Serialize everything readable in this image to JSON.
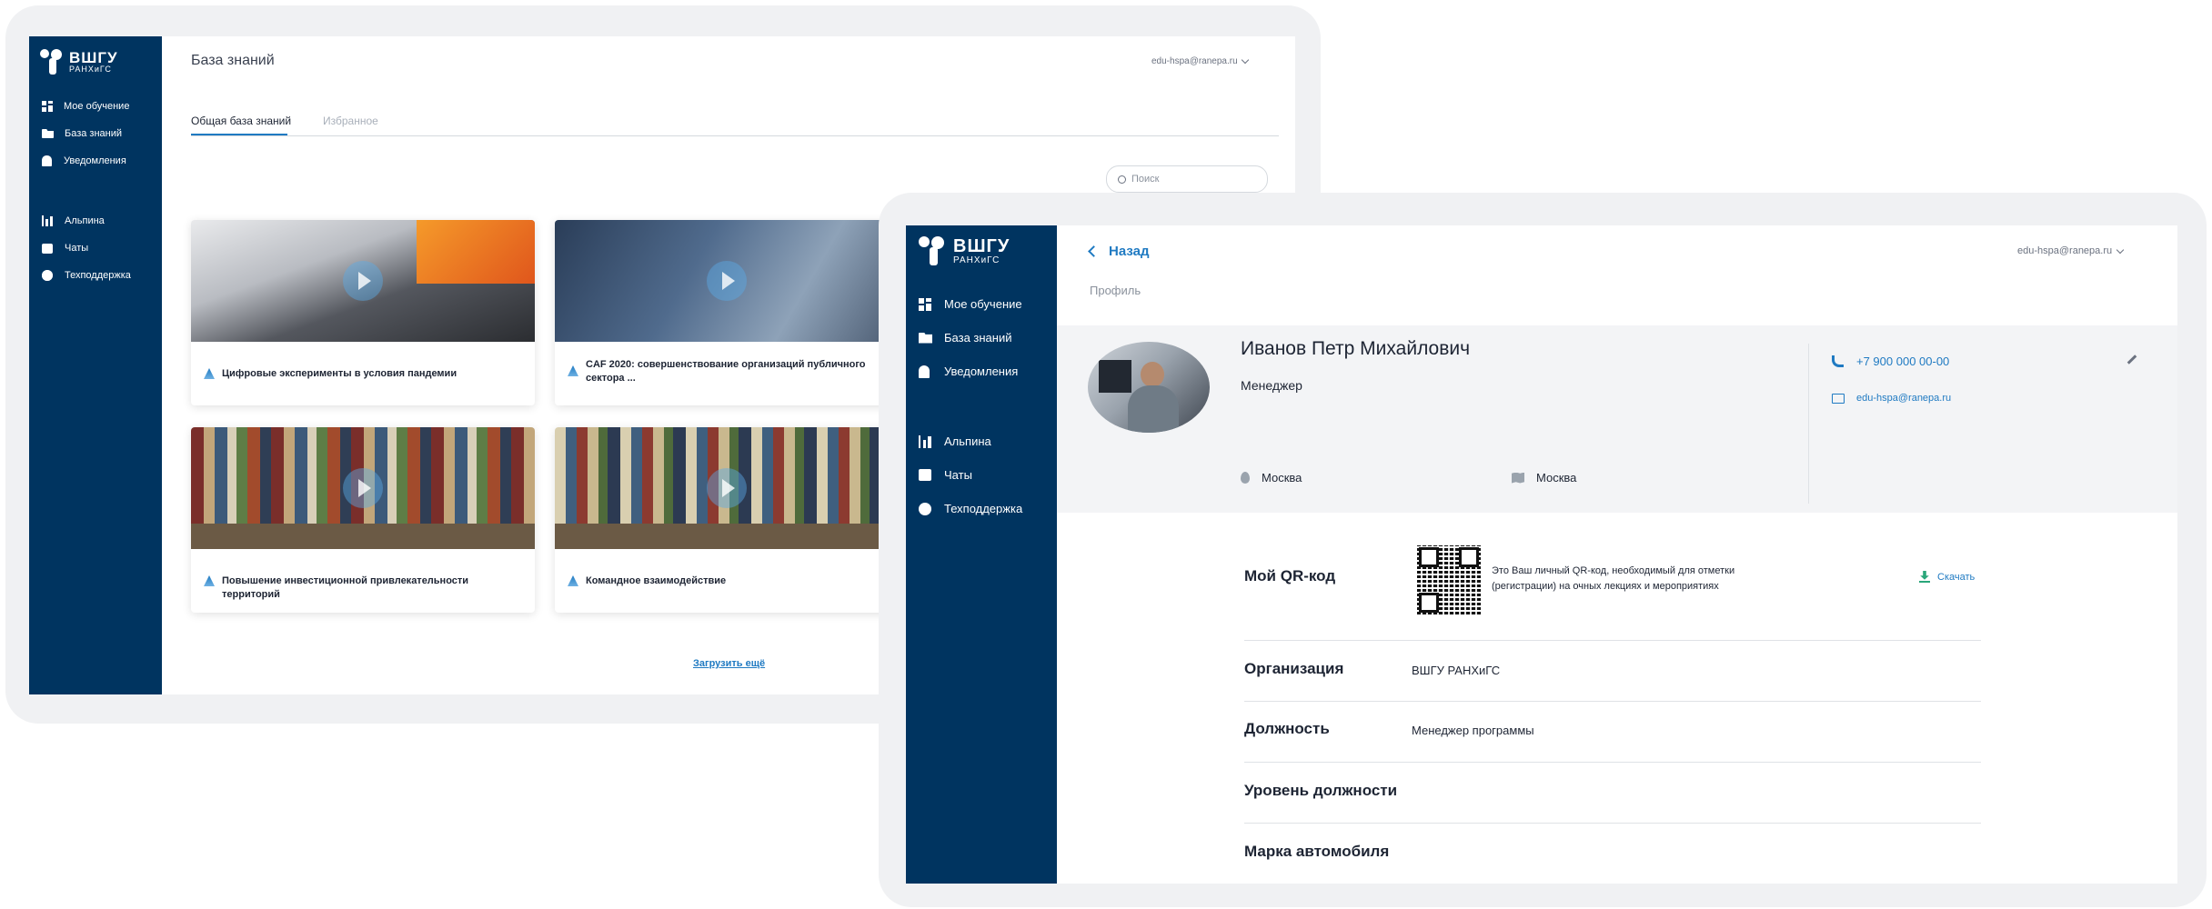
{
  "brand": {
    "line1": "ВШГУ",
    "line2": "РАНХиГС"
  },
  "back_screen": {
    "page_title": "База знаний",
    "user_email": "edu-hspa@ranepa.ru",
    "nav": [
      {
        "label": "Мое обучение",
        "icon": "grid-icon"
      },
      {
        "label": "База знаний",
        "icon": "folder-icon"
      },
      {
        "label": "Уведомления",
        "icon": "bell-icon"
      },
      {
        "label": "Альпина",
        "icon": "chart-icon"
      },
      {
        "label": "Чаты",
        "icon": "chat-icon"
      },
      {
        "label": "Техподдержка",
        "icon": "gear-icon"
      }
    ],
    "tabs": [
      "Общая база знаний",
      "Избранное"
    ],
    "search_placeholder": "Поиск",
    "cards": [
      {
        "title": "Цифровые эксперименты в условия пандемии"
      },
      {
        "title": "CAF 2020: совершенствование организаций публичного сектора ..."
      },
      {
        "title": "Повышение инвестиционной привлекательности территорий"
      },
      {
        "title": "Командное взаимодействие"
      }
    ],
    "load_more": "Загрузить ещё"
  },
  "front_screen": {
    "back_link": "Назад",
    "breadcrumb": "Профиль",
    "user_email": "edu-hspa@ranepa.ru",
    "nav": [
      {
        "label": "Мое обучение",
        "icon": "grid-icon"
      },
      {
        "label": "База знаний",
        "icon": "folder-icon"
      },
      {
        "label": "Уведомления",
        "icon": "bell-icon"
      },
      {
        "label": "Альпина",
        "icon": "chart-icon"
      },
      {
        "label": "Чаты",
        "icon": "chat-icon"
      },
      {
        "label": "Техподдержка",
        "icon": "gear-icon"
      }
    ],
    "profile": {
      "name": "Иванов Петр Михайлович",
      "role": "Менеджер",
      "city": "Москва",
      "region": "Москва",
      "phone": "+7 900 000 00-00",
      "email": "edu-hspa@ranepa.ru"
    },
    "qr": {
      "label": "Мой QR-код",
      "desc_line1": "Это Ваш личный QR-код, необходимый для отметки",
      "desc_line2": "(регистрации) на очных лекциях и мероприятиях",
      "download": "Скачать"
    },
    "fields": [
      {
        "label": "Организация",
        "value": "ВШГУ РАНХиГС"
      },
      {
        "label": "Должность",
        "value": "Менеджер программы"
      },
      {
        "label": "Уровень должности",
        "value": ""
      },
      {
        "label": "Марка автомобиля",
        "value": ""
      }
    ]
  },
  "colors": {
    "sidebar": "#003460",
    "accent": "#1f7ac2",
    "frame": "#f0f1f3"
  }
}
